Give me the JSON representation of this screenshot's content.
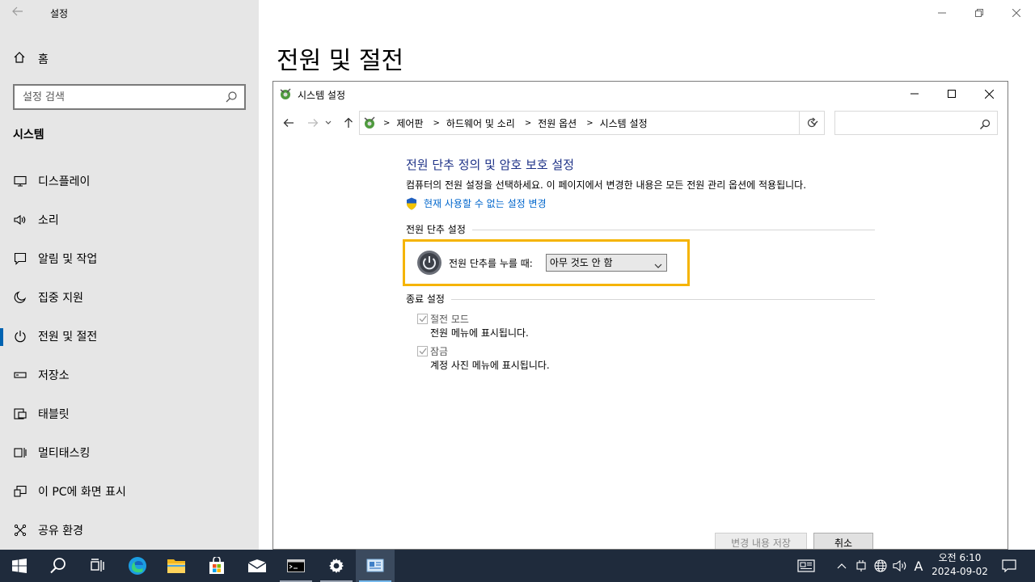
{
  "settings": {
    "app_title": "설정",
    "home_label": "홈",
    "search_placeholder": "설정 검색",
    "section_title": "시스템",
    "page_title": "전원 및 절전",
    "nav_items": [
      {
        "label": "디스플레이",
        "icon": "display-icon"
      },
      {
        "label": "소리",
        "icon": "speaker-icon"
      },
      {
        "label": "알림 및 작업",
        "icon": "notification-icon"
      },
      {
        "label": "집중 지원",
        "icon": "moon-icon"
      },
      {
        "label": "전원 및 절전",
        "icon": "power-icon",
        "active": true
      },
      {
        "label": "저장소",
        "icon": "storage-icon"
      },
      {
        "label": "태블릿",
        "icon": "tablet-icon"
      },
      {
        "label": "멀티태스킹",
        "icon": "multitasking-icon"
      },
      {
        "label": "이 PC에 화면 표시",
        "icon": "project-icon"
      },
      {
        "label": "공유 환경",
        "icon": "shared-experiences-icon"
      }
    ]
  },
  "control_panel": {
    "window_title": "시스템 설정",
    "breadcrumb": [
      "제어판",
      "하드웨어 및 소리",
      "전원 옵션",
      "시스템 설정"
    ],
    "heading": "전원 단추 정의 및 암호 보호 설정",
    "description": "컴퓨터의 전원 설정을 선택하세요. 이 페이지에서 변경한 내용은 모든 전원 관리 옵션에 적용됩니다.",
    "admin_link": "현재 사용할 수 없는 설정 변경",
    "power_group_label": "전원 단추 설정",
    "power_button_label": "전원 단추를 누를 때:",
    "power_button_value": "아무 것도 안 함",
    "shutdown_group_label": "종료 설정",
    "shutdown_options": [
      {
        "label": "절전 모드",
        "description": "전원 메뉴에 표시됩니다.",
        "checked": true
      },
      {
        "label": "잠금",
        "description": "계정 사진 메뉴에 표시됩니다.",
        "checked": true
      }
    ],
    "save_button": "변경 내용 저장",
    "cancel_button": "취소"
  },
  "taskbar": {
    "ime_indicator": "A",
    "time": "오전 6:10",
    "date": "2024-09-02"
  },
  "colors": {
    "accent": "#0063b1",
    "highlight_border": "#f5b400",
    "link": "#0066cc",
    "heading": "#1e3287",
    "taskbar": "#1f2b3c"
  }
}
